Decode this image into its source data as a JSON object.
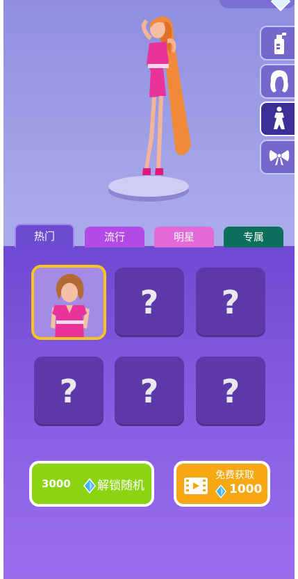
{
  "tabs": [
    {
      "label": "热门"
    },
    {
      "label": "流行"
    },
    {
      "label": "明星"
    },
    {
      "label": "专属"
    }
  ],
  "side_tools": [
    {
      "icon": "spray-bottle-icon"
    },
    {
      "icon": "hair-icon"
    },
    {
      "icon": "outfit-silhouette-icon",
      "active": true
    },
    {
      "icon": "bow-icon"
    }
  ],
  "grid": {
    "slots": [
      {
        "state": "selected",
        "content": "pink-dress-character"
      },
      {
        "state": "locked",
        "mark": "?"
      },
      {
        "state": "locked",
        "mark": "?"
      },
      {
        "state": "locked",
        "mark": "?"
      },
      {
        "state": "locked",
        "mark": "?"
      },
      {
        "state": "locked",
        "mark": "?"
      }
    ]
  },
  "buttons": {
    "unlock_random": {
      "price": "3000",
      "label": "解锁随机",
      "icon": "gem-icon"
    },
    "free_get": {
      "label": "免费获取",
      "amount": "1000",
      "icon": "video-icon"
    }
  },
  "colors": {
    "unlock_green": "#8ad412",
    "free_orange": "#f7a712",
    "selected_border": "#f8c51a",
    "panel_purple": "#6e4ad2"
  }
}
